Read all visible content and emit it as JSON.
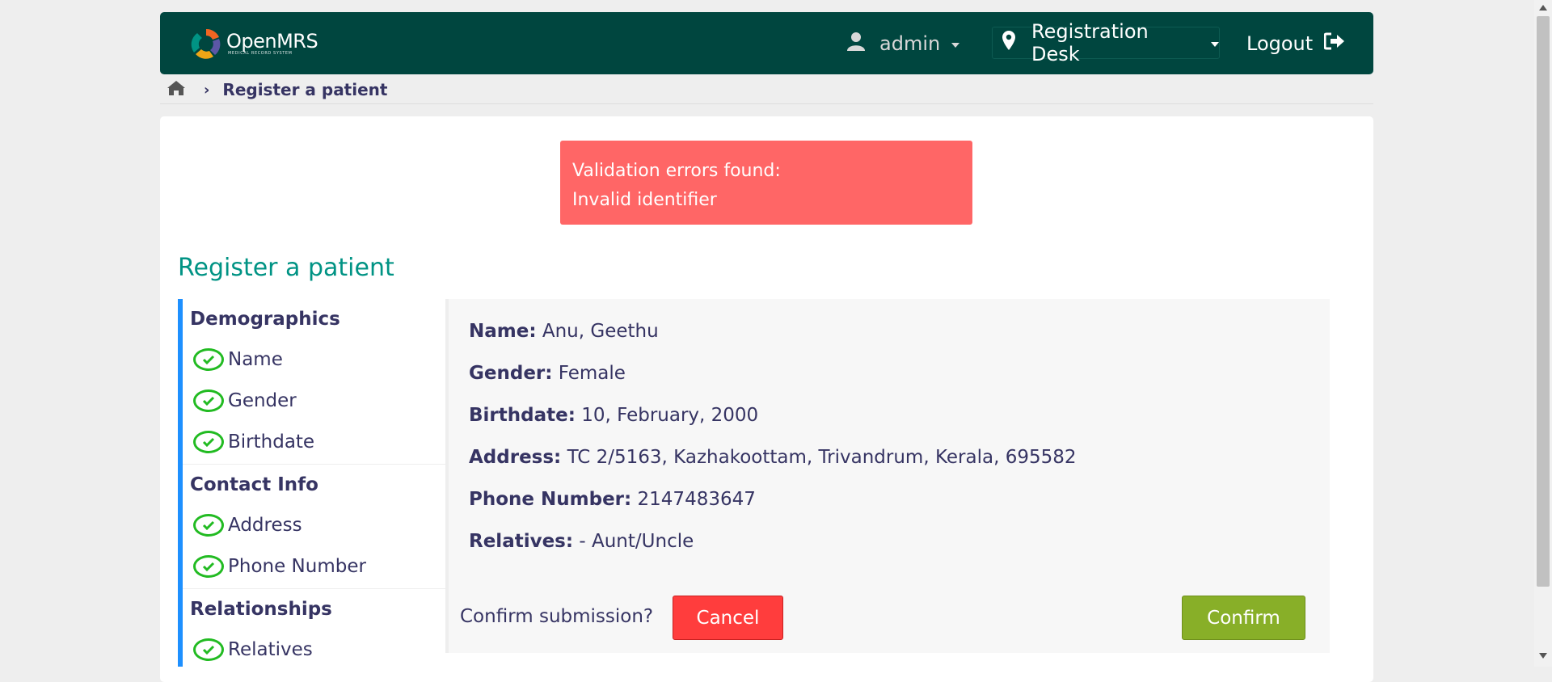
{
  "header": {
    "logo_text": "OpenMRS",
    "logo_subtext": "MEDICAL RECORD SYSTEM",
    "user": "admin",
    "location": "Registration Desk",
    "logout": "Logout",
    "icons": {
      "user": "user-icon",
      "location": "map-marker-icon",
      "logout": "sign-out-icon"
    }
  },
  "breadcrumb": {
    "current": "Register a patient",
    "icons": {
      "home": "home-icon",
      "separator": "chevron-right-icon"
    }
  },
  "error": {
    "line1": "Validation errors found:",
    "line2": "Invalid identifier"
  },
  "page_title": "Register a patient",
  "sidebar": {
    "sections": [
      {
        "title": "Demographics",
        "steps": [
          "Name",
          "Gender",
          "Birthdate"
        ]
      },
      {
        "title": "Contact Info",
        "steps": [
          "Address",
          "Phone Number"
        ]
      },
      {
        "title": "Relationships",
        "steps": [
          "Relatives"
        ]
      }
    ]
  },
  "summary": {
    "name_label": "Name:",
    "name_value": "Anu, Geethu",
    "gender_label": "Gender:",
    "gender_value": "Female",
    "birthdate_label": "Birthdate:",
    "birthdate_value": "10, February, 2000",
    "address_label": "Address:",
    "address_value": "TC 2/5163, Kazhakoottam, Trivandrum, Kerala, 695582",
    "phone_label": "Phone Number:",
    "phone_value": "2147483647",
    "relatives_label": "Relatives:",
    "relatives_value": "- Aunt/Uncle"
  },
  "confirm": {
    "question": "Confirm submission?",
    "cancel_label": "Cancel",
    "confirm_label": "Confirm"
  },
  "colors": {
    "header_bg": "#00463f",
    "title": "#009384",
    "error_bg": "#ff6666",
    "sidebar_accent": "#1e90ff",
    "check": "#22bb22",
    "cancel": "#ff3d3d",
    "confirm": "#88af28"
  }
}
